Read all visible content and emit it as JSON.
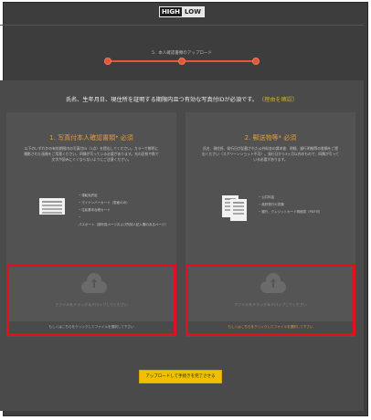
{
  "brand": {
    "hi": "HIGH",
    "lo": "LOW"
  },
  "step_label": "5．本人確認書類のアップロード",
  "headline": "氏名、生年月日、現住所を証明する期限内且つ有効な写真付IDが必須です。",
  "headline_note": "（理由を確認）",
  "panel_left": {
    "title": "1. 写真付本人確認書類* 必須",
    "description": "以下のいずれかの有効期限内の写真付ID（1点）を提出してください。カラーで鮮明に撮影された画像をご用意ください。四隅が写っている必要があります。光の反射や影で文字が読みにくくならないようにご注意ください。",
    "bullets": [
      "運転免許証",
      "マイナンバーカード（表面のみ）",
      "住民基本台帳カード",
      "パスポート（顔写真ページおよび所持人記入欄のあるページ）"
    ]
  },
  "panel_right": {
    "title": "2. 郵送物等* 必須",
    "description": "氏名、現住所、発行日が記載された公共料金の請求書、明細、銀行明細等の書類をご提出ください（スクリーンショット不可）。発行日から3ヶ月以内のもので、四隅が写っている必要があります。",
    "bullets": [
      "公共料金",
      "政府発行の書類",
      "銀行、クレジットカード明細書（PDF可）"
    ]
  },
  "dropzone": {
    "hint": "ファイルをドラッグ＆ドロップしてください",
    "select_left": "もしくはこちらをクリックしてファイルを選択して下さい",
    "select_right": "もしくはこちらをクリックしてファイルを選択して下さい"
  },
  "submit_label": "アップロードして手続きを完了させる",
  "colors": {
    "accent": "#e39b3a",
    "highlight": "#e01020",
    "button": "#f0c000",
    "progress": "#e0583a"
  }
}
